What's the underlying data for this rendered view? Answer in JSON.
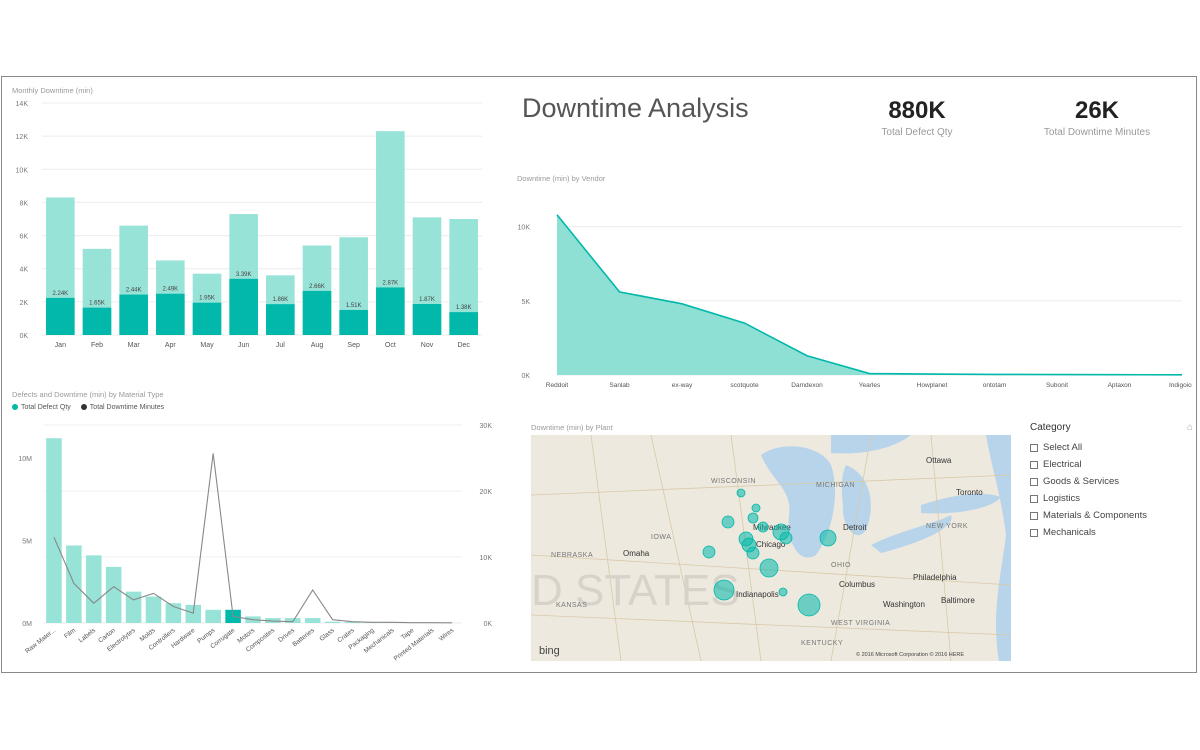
{
  "dashboard": {
    "title": "Downtime Analysis",
    "kpis": [
      {
        "value": "880K",
        "label": "Total Defect Qty"
      },
      {
        "value": "26K",
        "label": "Total Downtime Minutes"
      }
    ]
  },
  "colors": {
    "light_teal": "#98e3d7",
    "teal": "#01b8aa",
    "line": "#888888",
    "area": "#8fe0d4"
  },
  "chart_data": [
    {
      "type": "bar",
      "title": "Monthly Downtime (min)",
      "categories": [
        "Jan",
        "Feb",
        "Mar",
        "Apr",
        "May",
        "Jun",
        "Jul",
        "Aug",
        "Sep",
        "Oct",
        "Nov",
        "Dec"
      ],
      "series": [
        {
          "values": [
            8300,
            5200,
            6600,
            4500,
            3700,
            7300,
            3600,
            5400,
            5900,
            12300,
            7100,
            7000
          ]
        },
        {
          "values": [
            2240,
            1650,
            2440,
            2490,
            1950,
            3390,
            1860,
            2660,
            1510,
            2870,
            1870,
            1380
          ]
        }
      ],
      "data_labels": [
        "2.24K",
        "1.65K",
        "2.44K",
        "2.49K",
        "1.95K",
        "3.39K",
        "1.86K",
        "2.66K",
        "1.51K",
        "2.87K",
        "1.87K",
        "1.38K"
      ],
      "y_ticks": [
        "0K",
        "2K",
        "4K",
        "6K",
        "8K",
        "10K",
        "12K",
        "14K"
      ],
      "ylim": [
        0,
        14000
      ],
      "grid": true
    },
    {
      "type": "area",
      "title": "Downtime (min) by Vendor",
      "categories": [
        "Reddoit",
        "Sanlab",
        "ex-way",
        "scotquote",
        "Damdexon",
        "Yearles",
        "Howplanet",
        "ontotam",
        "Subonit",
        "Aptaxon",
        "Indigoice"
      ],
      "values": [
        10800,
        5600,
        4800,
        3500,
        1300,
        100,
        60,
        40,
        30,
        20,
        10
      ],
      "y_ticks": [
        "0K",
        "5K",
        "10K"
      ],
      "ylim": [
        0,
        12000
      ],
      "grid": true
    },
    {
      "type": "bar",
      "title": "Defects and Downtime (min) by Material Type",
      "legend": [
        "Total Defect Qty",
        "Total Downtime Minutes"
      ],
      "categories": [
        "Raw Mater...",
        "Film",
        "Labels",
        "Carton",
        "Electrolytes",
        "Molds",
        "Controllers",
        "Hardware",
        "Pumps",
        "Corrugate",
        "Motors",
        "Composites",
        "Drives",
        "Batteries",
        "Glass",
        "Crates",
        "Packaging",
        "Mechanicals",
        "Tape",
        "Printed Materials",
        "Wires"
      ],
      "bar_values": [
        11200000,
        4700000,
        4100000,
        3400000,
        1900000,
        1600000,
        1200000,
        1100000,
        800000,
        800000,
        400000,
        300000,
        300000,
        300000,
        80000,
        60000,
        50000,
        40000,
        30000,
        20000,
        10000
      ],
      "line_values": [
        13000,
        6000,
        3000,
        5500,
        3500,
        4500,
        2500,
        1500,
        25700,
        1000,
        500,
        300,
        200,
        5000,
        500,
        200,
        100,
        100,
        50,
        50,
        30
      ],
      "y_ticks_left": [
        "0M",
        "5M",
        "10M"
      ],
      "y_ticks_right": [
        "0K",
        "10K",
        "20K",
        "30K"
      ],
      "ylim_left": [
        0,
        12000000
      ],
      "ylim_right": [
        0,
        30000
      ],
      "highlighted_category": "Corrugate"
    }
  ],
  "map": {
    "title": "Downtime (min) by Plant",
    "watermark": "D STATES",
    "logo": "bing",
    "attribution": "© 2016 Microsoft Corporation   © 2016 HERE",
    "places": [
      {
        "name": "WISCONSIN"
      },
      {
        "name": "MICHIGAN"
      },
      {
        "name": "IOWA"
      },
      {
        "name": "NEBRASKA"
      },
      {
        "name": "KANSAS"
      },
      {
        "name": "OHIO"
      },
      {
        "name": "NEW YORK"
      },
      {
        "name": "KENTUCKY"
      },
      {
        "name": "WEST VIRGINIA"
      },
      {
        "name": "Detroit"
      },
      {
        "name": "Milwaukee"
      },
      {
        "name": "Chicago"
      },
      {
        "name": "Columbus"
      },
      {
        "name": "Indianapolis"
      },
      {
        "name": "Philadelphia"
      },
      {
        "name": "Washington"
      },
      {
        "name": "Ottawa"
      },
      {
        "name": "Toronto"
      },
      {
        "name": "Omaha"
      },
      {
        "name": "Baltimore"
      }
    ]
  },
  "slicer": {
    "title": "Category",
    "items": [
      "Select All",
      "Electrical",
      "Goods & Services",
      "Logistics",
      "Materials & Components",
      "Mechanicals"
    ]
  }
}
